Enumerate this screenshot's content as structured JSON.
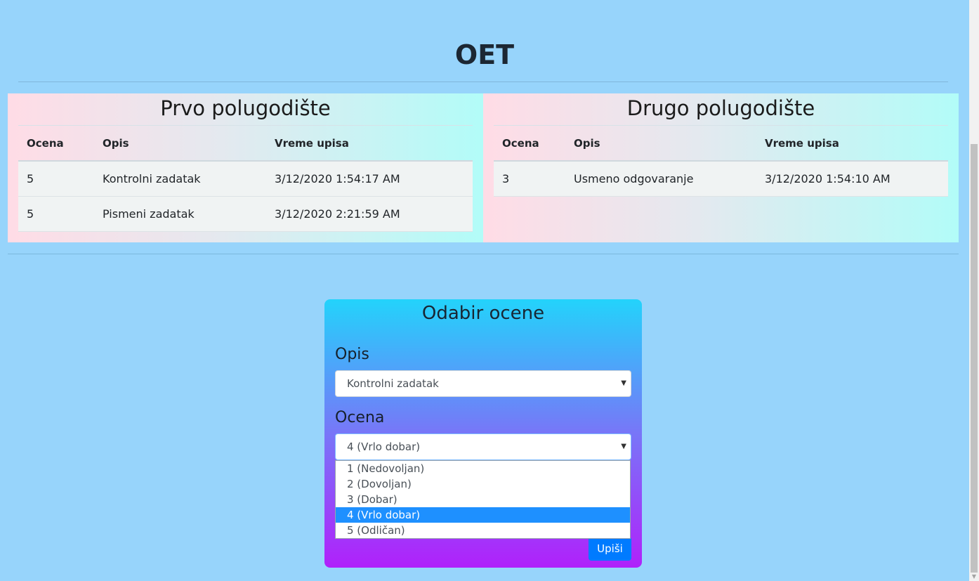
{
  "page": {
    "title": "OET"
  },
  "semesters": [
    {
      "title": "Prvo polugodište",
      "columns": [
        "Ocena",
        "Opis",
        "Vreme upisa"
      ],
      "rows": [
        [
          "5",
          "Kontrolni zadatak",
          "3/12/2020 1:54:17 AM"
        ],
        [
          "5",
          "Pismeni zadatak",
          "3/12/2020 2:21:59 AM"
        ]
      ]
    },
    {
      "title": "Drugo polugodište",
      "columns": [
        "Ocena",
        "Opis",
        "Vreme upisa"
      ],
      "rows": [
        [
          "3",
          "Usmeno odgovaranje",
          "3/12/2020 1:54:10 AM"
        ]
      ]
    }
  ],
  "form": {
    "title": "Odabir ocene",
    "opis_label": "Opis",
    "opis_value": "Kontrolni zadatak",
    "ocena_label": "Ocena",
    "ocena_value": "4 (Vrlo dobar)",
    "ocena_options": [
      "1 (Nedovoljan)",
      "2 (Dovoljan)",
      "3 (Dobar)",
      "4 (Vrlo dobar)",
      "5 (Odličan)"
    ],
    "ocena_selected_index": 3,
    "submit_label": "Upiši",
    "caret_glyph": "▼"
  },
  "colors": {
    "background": "#97d4fb",
    "submit_button": "#007bff",
    "selected_option": "#1e90ff"
  }
}
